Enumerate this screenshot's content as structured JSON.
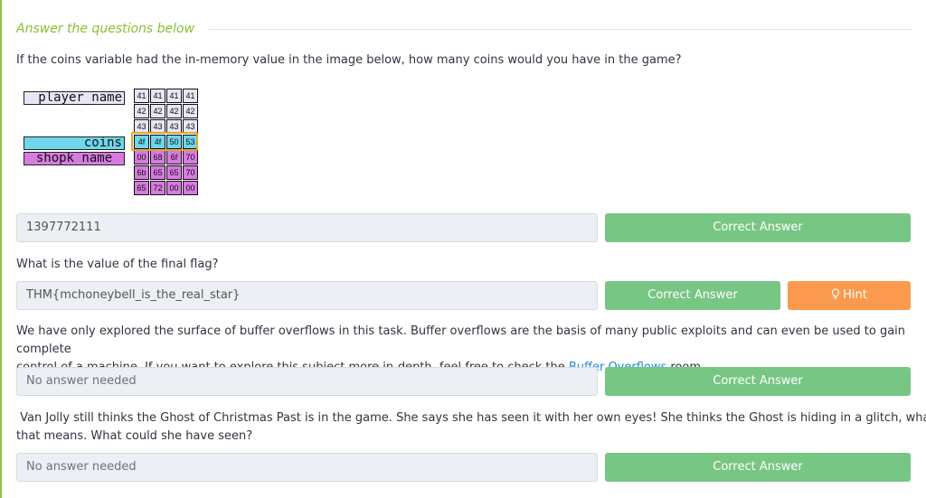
{
  "section": {
    "title": "Answer the questions below"
  },
  "questions": [
    {
      "text": "If the coins variable had the in-memory value in the image below, how many coins would you have in the game?",
      "answer": "1397772111",
      "button": "Correct Answer"
    },
    {
      "text": "What is the value of the final flag?",
      "answer": "THM{mchoneybell_is_the_real_star}",
      "button": "Correct Answer",
      "hint": "Hint"
    },
    {
      "text_line1": "We have only explored the surface of buffer overflows in this task. Buffer overflows are the basis of many public exploits and can even be used to gain complete",
      "text_line2_before": "control of a machine. If you want to explore this subject more in-depth, feel free to check the ",
      "link": "Buffer Overflows",
      "text_line2_after": " room.",
      "answer": "No answer needed",
      "button": "Correct Answer"
    },
    {
      "text_line1": " Van Jolly still thinks the Ghost of Christmas Past is in the game. She says she has seen it with her own eyes! She thinks the Ghost is hiding in a glitch, whatever",
      "text_line2": "that means. What could she have seen?",
      "answer": "No answer needed",
      "button": "Correct Answer"
    }
  ],
  "diagram": {
    "labels": {
      "player_name": "player_name",
      "coins": "coins",
      "shopk_name": "shopk_name"
    },
    "memory_rows": [
      [
        "41",
        "41",
        "41",
        "41"
      ],
      [
        "42",
        "42",
        "42",
        "42"
      ],
      [
        "43",
        "43",
        "43",
        "43"
      ],
      [
        "4f",
        "4f",
        "50",
        "53"
      ],
      [
        "00",
        "68",
        "6f",
        "70"
      ],
      [
        "6b",
        "65",
        "65",
        "70"
      ],
      [
        "65",
        "72",
        "00",
        "00"
      ]
    ],
    "row_colors": [
      "#e8e5f5",
      "#e8e5f5",
      "#e8e5f5",
      "#6fd6ec",
      "#d67be0",
      "#d67be0",
      "#d67be0"
    ],
    "highlight_color": "#e4a829"
  },
  "colors": {
    "accent": "#86c232",
    "correct": "#78c684",
    "hint": "#fb9a4f",
    "link": "#1e88e5"
  }
}
